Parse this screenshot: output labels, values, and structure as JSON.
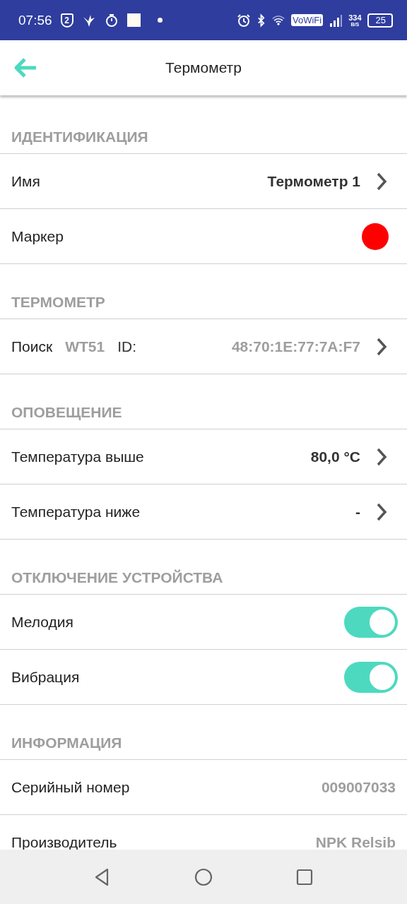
{
  "status_bar": {
    "time": "07:56",
    "shield_badge": "2",
    "vowifi": "VoWiFi",
    "speed_value": "334",
    "speed_unit": "B/S",
    "battery": "25"
  },
  "app_bar": {
    "title": "Термометр"
  },
  "sections": [
    {
      "title": "ИДЕНТИФИКАЦИЯ",
      "rows": [
        {
          "kind": "nav",
          "label": "Имя",
          "value": "Термометр 1",
          "bold": true
        },
        {
          "kind": "marker",
          "label": "Маркер",
          "color": "#ff0000"
        }
      ]
    },
    {
      "title": "ТЕРМОМЕТР",
      "rows": [
        {
          "kind": "search",
          "label": "Поиск",
          "model": "WT51",
          "id_label": "ID:",
          "value": "48:70:1E:77:7A:F7"
        }
      ]
    },
    {
      "title": "ОПОВЕЩЕНИЕ",
      "rows": [
        {
          "kind": "nav",
          "label": "Температура выше",
          "value": "80,0 °C",
          "bold": true
        },
        {
          "kind": "nav",
          "label": "Температура ниже",
          "value": "-",
          "bold": true
        }
      ]
    },
    {
      "title": "ОТКЛЮЧЕНИЕ УСТРОЙСТВА",
      "rows": [
        {
          "kind": "toggle",
          "label": "Мелодия",
          "on": true
        },
        {
          "kind": "toggle",
          "label": "Вибрация",
          "on": true
        }
      ]
    },
    {
      "title": "ИНФОРМАЦИЯ",
      "rows": [
        {
          "kind": "info",
          "label": "Серийный номер",
          "value": "009007033"
        },
        {
          "kind": "info",
          "label": "Производитель",
          "value": "NPK Relsib"
        }
      ]
    }
  ]
}
